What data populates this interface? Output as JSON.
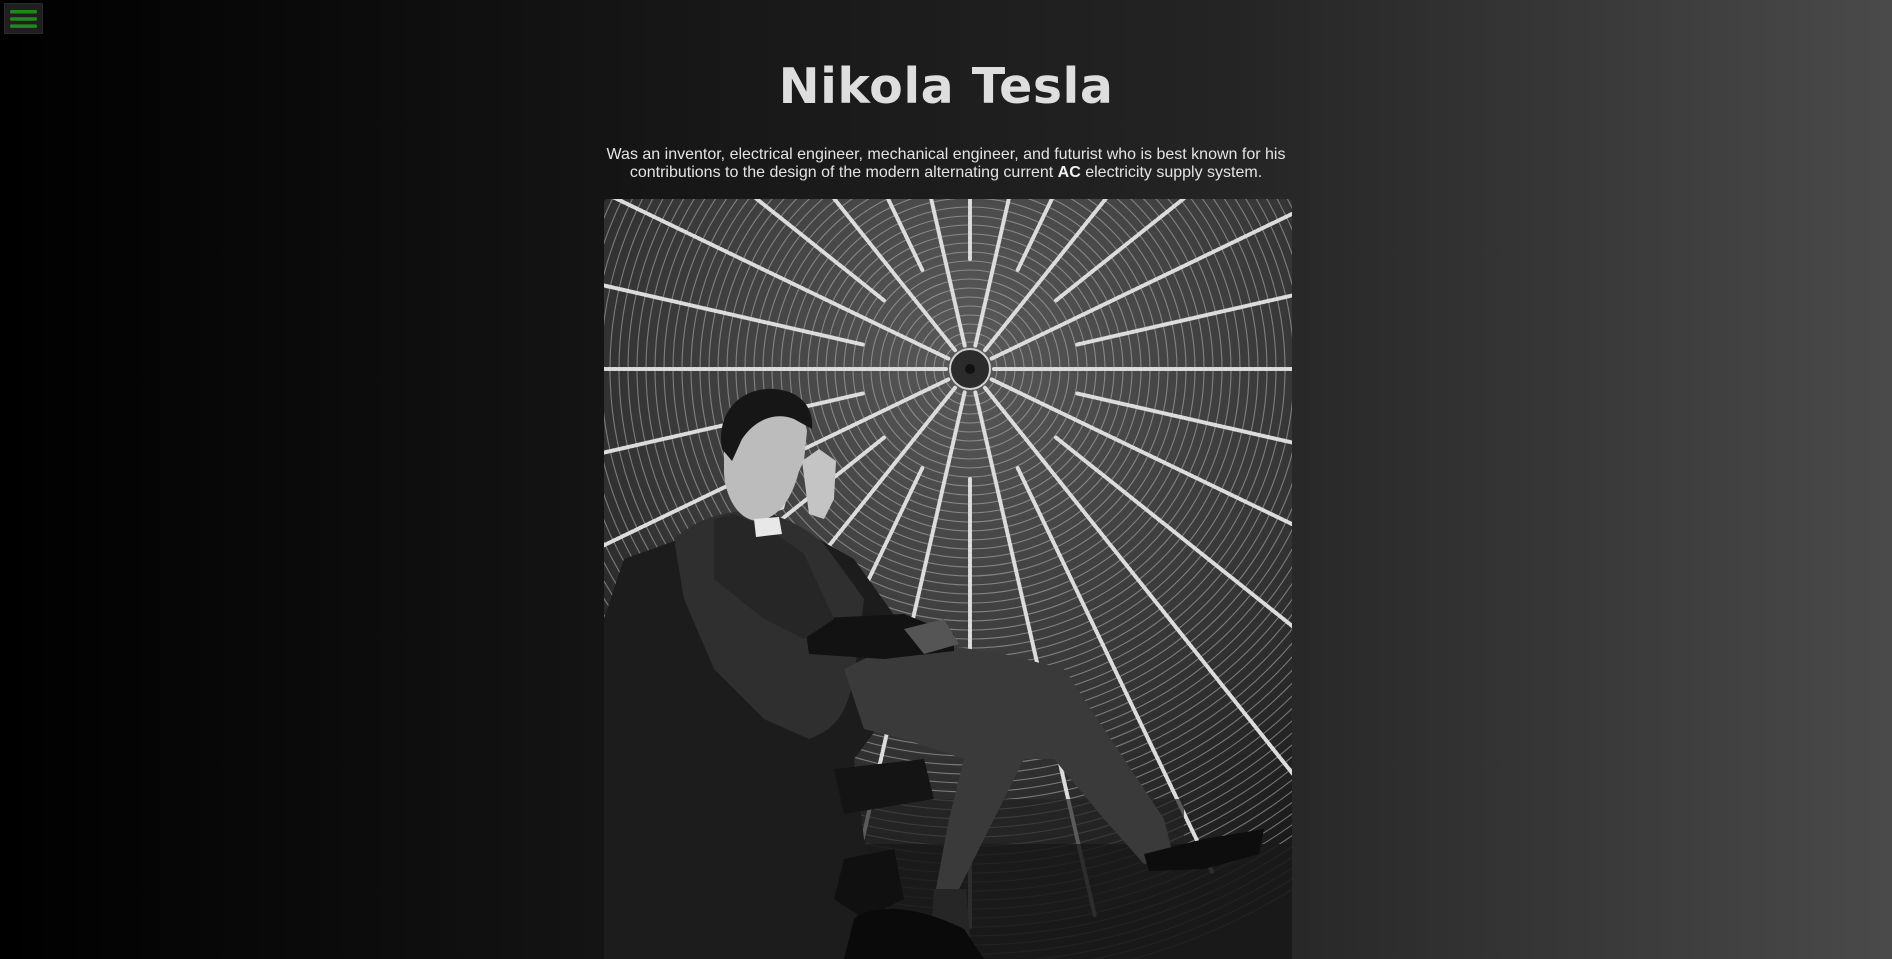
{
  "menu": {
    "icon": "hamburger-icon",
    "icon_color": "#1e8a1e"
  },
  "hero": {
    "title": "Nikola Tesla",
    "description_before": "Was an inventor, electrical engineer, mechanical engineer, and futurist who is best known for his contributions to the design of the modern alternating current ",
    "description_bold": "AC",
    "description_after": " electricity supply system."
  },
  "photo": {
    "subject": "tesla-seated-under-spiral-coil-photo"
  },
  "colors": {
    "background_left": "#000000",
    "background_right": "#4a4a4a",
    "title": "#dedede",
    "text": "#e4e4e4",
    "accent": "#1e8a1e"
  }
}
